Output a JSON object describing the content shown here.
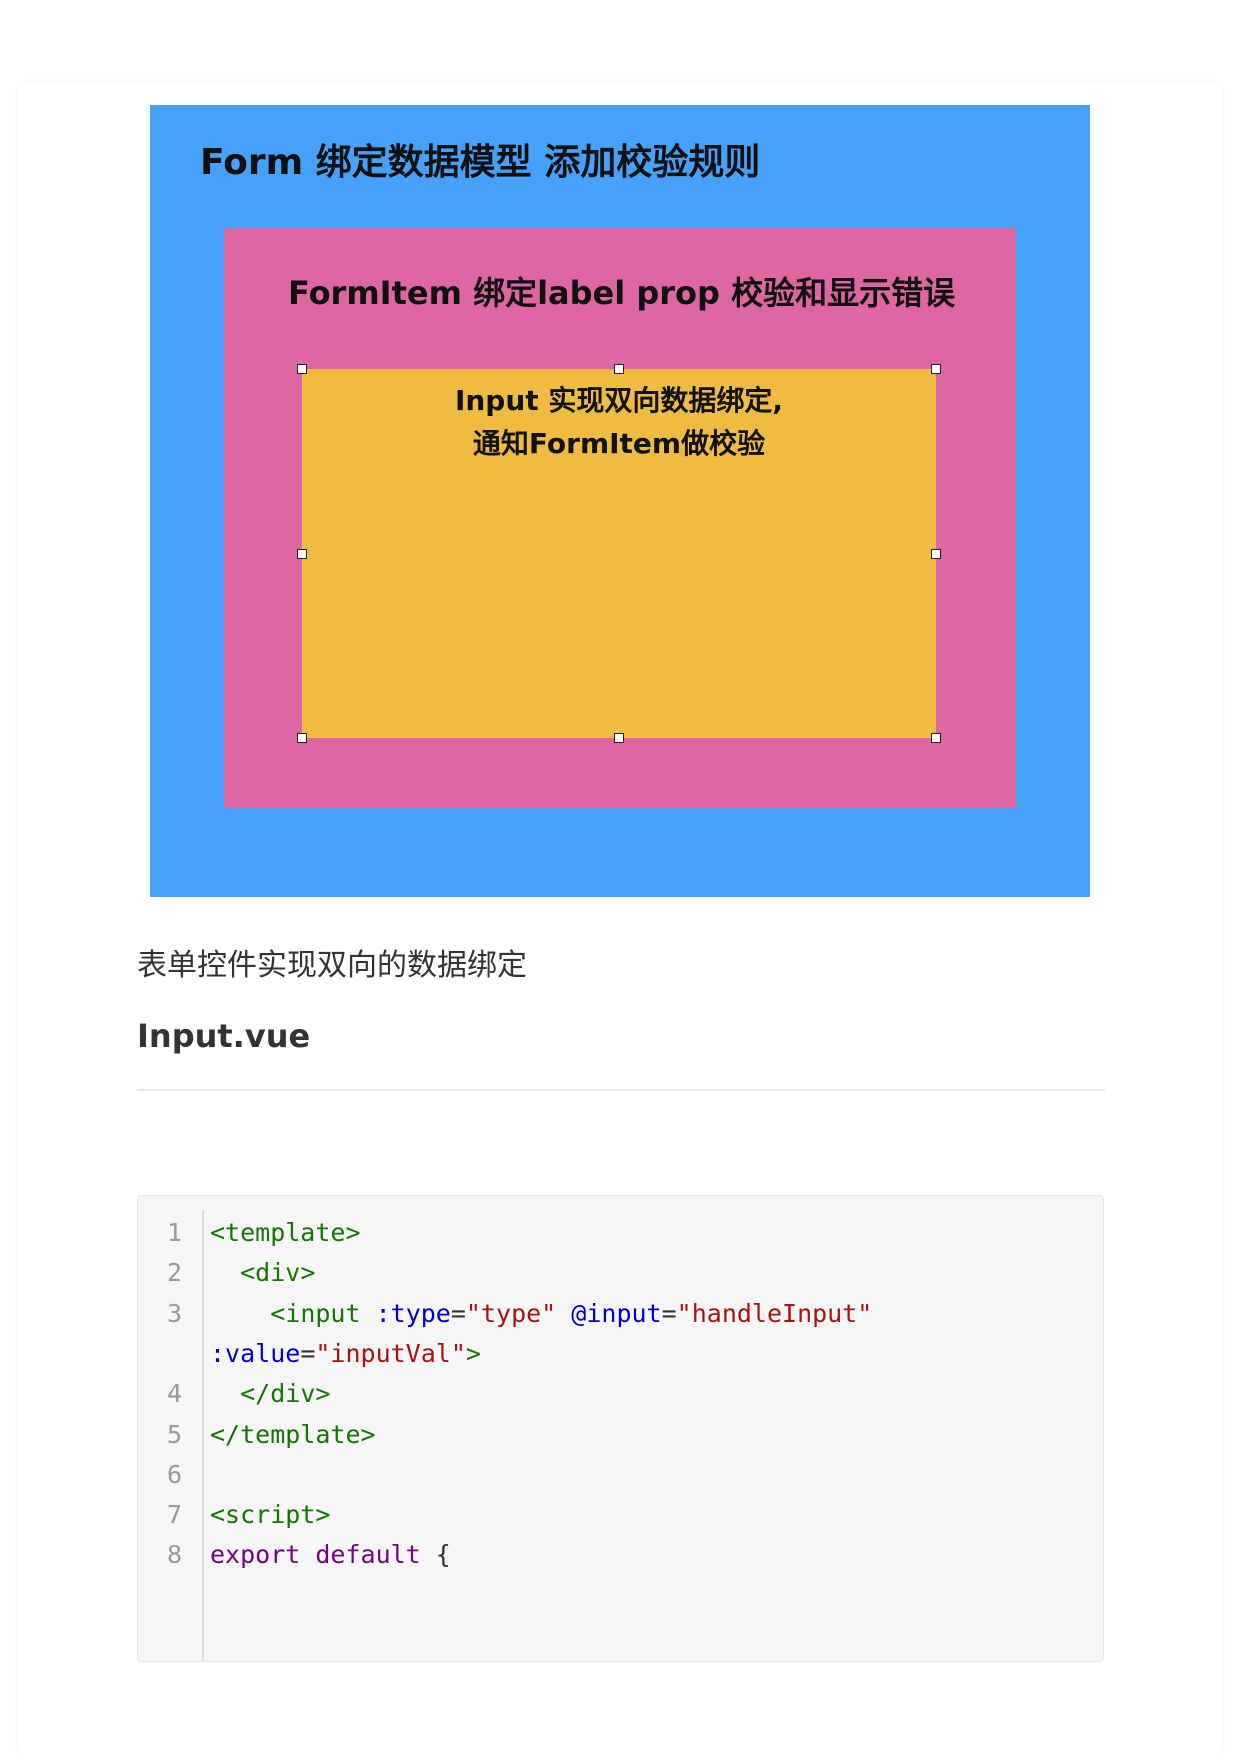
{
  "diagram": {
    "form_title": "Form  绑定数据模型 添加校验规则",
    "form_item_title": "FormItem 绑定label prop  校验和显示错误",
    "input_title_line1": "Input 实现双向数据绑定,",
    "input_title_line2": "通知FormItem做校验",
    "colors": {
      "form": "#46a1fa",
      "form_item": "#de67a3",
      "input": "#efbb41"
    }
  },
  "caption": "表单控件实现双向的数据绑定",
  "file_heading": "Input.vue",
  "code": {
    "lines": [
      {
        "n": "1",
        "tokens": [
          {
            "t": "<template>",
            "c": "tag"
          }
        ]
      },
      {
        "n": "2",
        "tokens": [
          {
            "t": "  ",
            "c": "plain"
          },
          {
            "t": "<div>",
            "c": "tag"
          }
        ]
      },
      {
        "n": "3",
        "tokens": [
          {
            "t": "    ",
            "c": "plain"
          },
          {
            "t": "<input",
            "c": "tag"
          },
          {
            "t": " ",
            "c": "plain"
          },
          {
            "t": ":type",
            "c": "attr"
          },
          {
            "t": "=",
            "c": "plain"
          },
          {
            "t": "\"type\"",
            "c": "str"
          },
          {
            "t": " ",
            "c": "plain"
          },
          {
            "t": "@input",
            "c": "attr"
          },
          {
            "t": "=",
            "c": "plain"
          },
          {
            "t": "\"handleInput\"",
            "c": "str"
          }
        ]
      },
      {
        "n": "",
        "tokens": [
          {
            "t": ":value",
            "c": "attr"
          },
          {
            "t": "=",
            "c": "plain"
          },
          {
            "t": "\"inputVal\"",
            "c": "str"
          },
          {
            "t": ">",
            "c": "tag"
          }
        ]
      },
      {
        "n": "4",
        "tokens": [
          {
            "t": "  ",
            "c": "plain"
          },
          {
            "t": "</div>",
            "c": "tag"
          }
        ]
      },
      {
        "n": "5",
        "tokens": [
          {
            "t": "</template>",
            "c": "tag"
          }
        ]
      },
      {
        "n": "6",
        "tokens": []
      },
      {
        "n": "7",
        "tokens": [
          {
            "t": "<script>",
            "c": "tag"
          }
        ]
      },
      {
        "n": "8",
        "tokens": [
          {
            "t": "export",
            "c": "kw"
          },
          {
            "t": " ",
            "c": "plain"
          },
          {
            "t": "default",
            "c": "kw"
          },
          {
            "t": " {",
            "c": "plain"
          }
        ]
      }
    ]
  }
}
